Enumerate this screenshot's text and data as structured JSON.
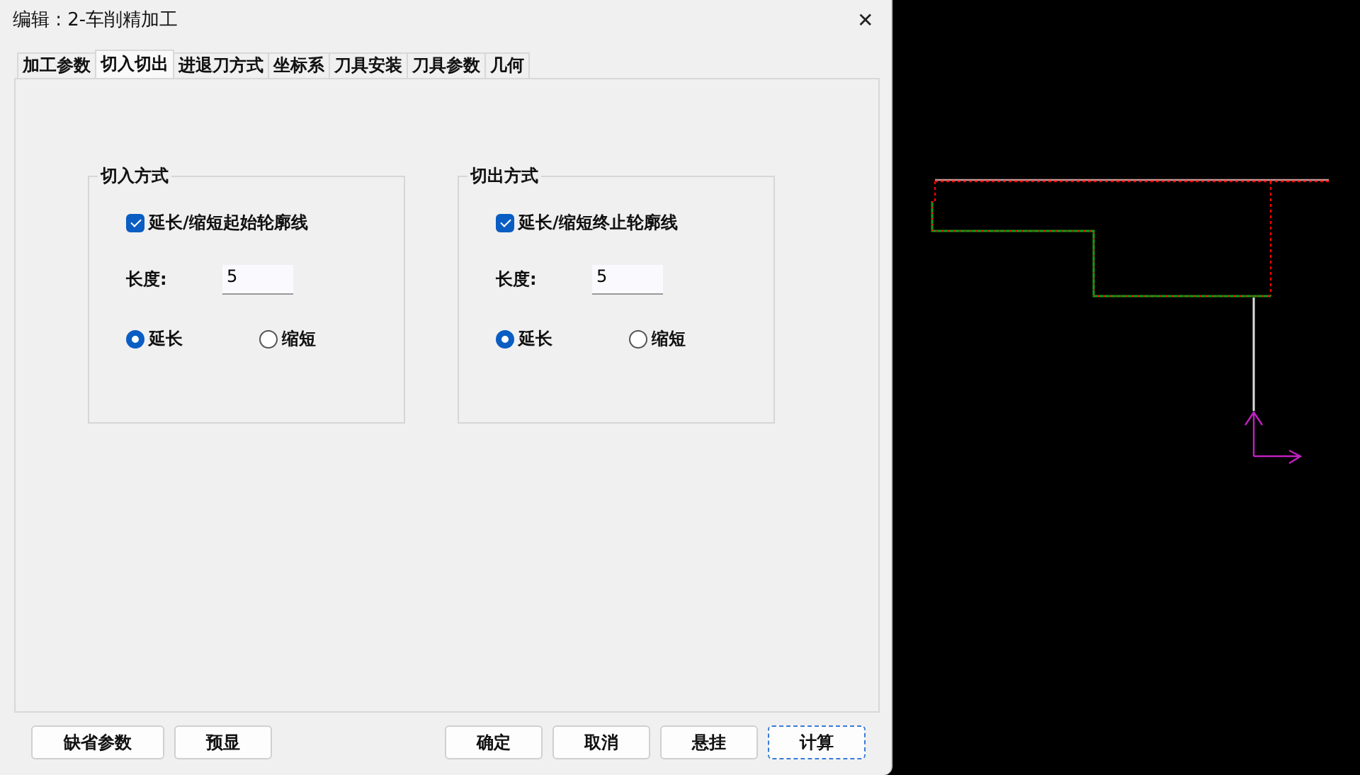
{
  "window": {
    "title": "编辑 : 2-车削精加工",
    "close": "✕"
  },
  "tabs": [
    {
      "label": "加工参数",
      "selected": false
    },
    {
      "label": "切入切出",
      "selected": true
    },
    {
      "label": "进退刀方式",
      "selected": false
    },
    {
      "label": "坐标系",
      "selected": false
    },
    {
      "label": "刀具安装",
      "selected": false
    },
    {
      "label": "刀具参数",
      "selected": false
    },
    {
      "label": "几何",
      "selected": false
    }
  ],
  "groups": [
    {
      "title": "切入方式",
      "checkbox": {
        "label": "延长/缩短起始轮廓线",
        "checked": true
      },
      "length": {
        "label": "长度:",
        "value": "5"
      },
      "radios": [
        {
          "label": "延长",
          "selected": true
        },
        {
          "label": "缩短",
          "selected": false
        }
      ]
    },
    {
      "title": "切出方式",
      "checkbox": {
        "label": "延长/缩短终止轮廓线",
        "checked": true
      },
      "length": {
        "label": "长度:",
        "value": "5"
      },
      "radios": [
        {
          "label": "延长",
          "selected": true
        },
        {
          "label": "缩短",
          "selected": false
        }
      ]
    }
  ],
  "buttons_left": [
    {
      "label": "缺省参数",
      "focused": false
    },
    {
      "label": "预显",
      "focused": false
    }
  ],
  "buttons_right": [
    {
      "label": "确定",
      "focused": false
    },
    {
      "label": "取消",
      "focused": false
    },
    {
      "label": "悬挂",
      "focused": false
    },
    {
      "label": "计算",
      "focused": true
    }
  ]
}
